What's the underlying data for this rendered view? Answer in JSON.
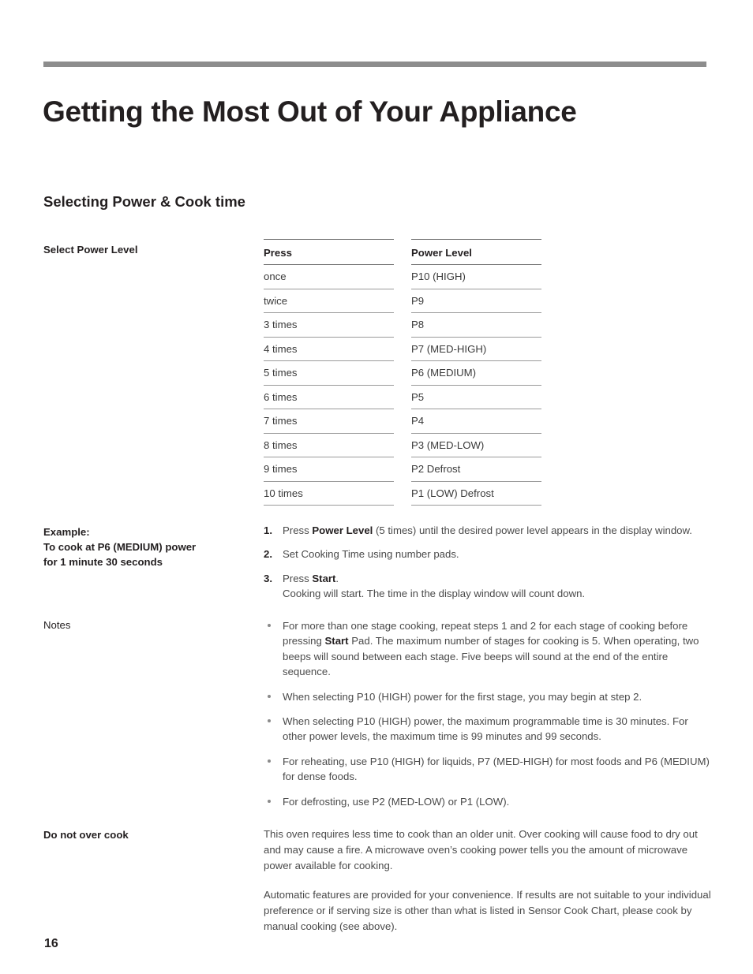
{
  "document": {
    "title": "Getting the Most Out of Your Appliance",
    "page_number": "16",
    "rule_color": "#8d8d8d",
    "text_color": "#231f20"
  },
  "section": {
    "heading": "Selecting Power & Cook time"
  },
  "labels": {
    "select_power_level": "Select Power Level",
    "example": "Example:\nTo cook at P6 (MEDIUM) power\nfor 1 minute 30 seconds",
    "notes": "Notes",
    "do_not_over_cook": "Do not over cook"
  },
  "power_table": {
    "headers": [
      "Press",
      "Power Level"
    ],
    "rows": [
      {
        "press": "once",
        "level": "P10 (HIGH)"
      },
      {
        "press": "twice",
        "level": "P9"
      },
      {
        "press": "3 times",
        "level": "P8"
      },
      {
        "press": "4 times",
        "level": "P7 (MED-HIGH)"
      },
      {
        "press": "5 times",
        "level": "P6 (MEDIUM)"
      },
      {
        "press": "6 times",
        "level": "P5"
      },
      {
        "press": "7 times",
        "level": "P4"
      },
      {
        "press": "8 times",
        "level": "P3 (MED-LOW)"
      },
      {
        "press": "9 times",
        "level": "P2 Defrost"
      },
      {
        "press": "10 times",
        "level": "P1 (LOW) Defrost"
      }
    ]
  },
  "steps": [
    {
      "number": "1.",
      "html": "Press <b>Power Level</b> (5 times) until the desired power level appears in the display window."
    },
    {
      "number": "2.",
      "html": "Set Cooking Time using number pads."
    },
    {
      "number": "3.",
      "html": "Press <b>Start</b>.<br>Cooking will start. The time in the display window will count down."
    }
  ],
  "notes": [
    {
      "html": "For more than one stage cooking, repeat steps 1 and 2 for each stage of cooking before pressing <b>Start</b> Pad. The maximum number of stages for cooking is 5. When operating, two beeps will sound between each stage. Five beeps will sound at the end of the entire sequence."
    },
    {
      "html": "When selecting P10 (HIGH) power for the first stage, you may begin at step 2."
    },
    {
      "html": "When selecting P10 (HIGH) power, the maximum programmable time is 30 minutes. For other power levels, the maximum time is 99 minutes and 99 seconds."
    },
    {
      "html": "For reheating, use P10 (HIGH) for liquids, P7 (MED-HIGH) for most foods and P6 (MEDIUM) for dense foods."
    },
    {
      "html": "For defrosting, use P2 (MED-LOW) or P1 (LOW)."
    }
  ],
  "do_not_over_cook": {
    "paragraphs": [
      "This oven requires less time to cook than an older unit. Over cooking will cause food to dry out and may cause a fire. A microwave oven’s cooking power tells you the amount of microwave power available for cooking.",
      "Automatic features are provided for your convenience. If results are not suitable to your individual preference or if serving size is other than what is listed in Sensor Cook Chart, please cook by manual cooking (see above)."
    ]
  }
}
